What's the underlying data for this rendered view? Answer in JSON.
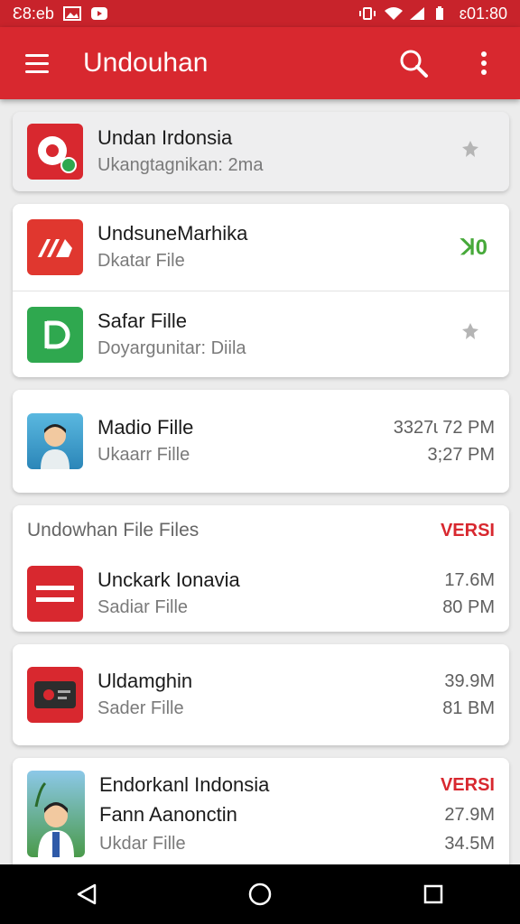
{
  "status_bar": {
    "left_text": "Ɛ8:eb",
    "right_text": "ɛ01:80"
  },
  "app_bar": {
    "title": "Undouhan"
  },
  "items_top": [
    {
      "title": "Undan Irdonsia",
      "subtitle": "Ukangtagnikan: 2ma"
    }
  ],
  "items_group": [
    {
      "title": "UndsuneMarhika",
      "subtitle": "Dkatar File",
      "badge": "ꓘ0"
    },
    {
      "title": "Safar Fille",
      "subtitle": "Doyargunitar: Diila"
    }
  ],
  "item_media": {
    "title": "Madio Fille",
    "subtitle": "Ukaarr Fille",
    "meta1": "3327ɩ 72 PM",
    "meta2": "3;27 PM"
  },
  "section": {
    "title": "Undowhan File Files",
    "badge": "VERSI",
    "item": {
      "title": "Unckark Ionavia",
      "subtitle": "Sadiar Fille",
      "meta1": "17.6M",
      "meta2": "80 PM"
    }
  },
  "item_video": {
    "title": "Uldamghin",
    "subtitle": "Sader Fille",
    "meta1": "39.9M",
    "meta2": "81 BM"
  },
  "item_bottom": {
    "badge": "VERSI",
    "title": "Endorkanl Indonsia",
    "subtitle_top": "Fann Aanonctin",
    "subtitle": "Ukdar Fille",
    "meta1": "27.9M",
    "meta2": "34.5M"
  },
  "colors": {
    "primary": "#d8282f",
    "status": "#c8232b",
    "green": "#47a93a"
  }
}
